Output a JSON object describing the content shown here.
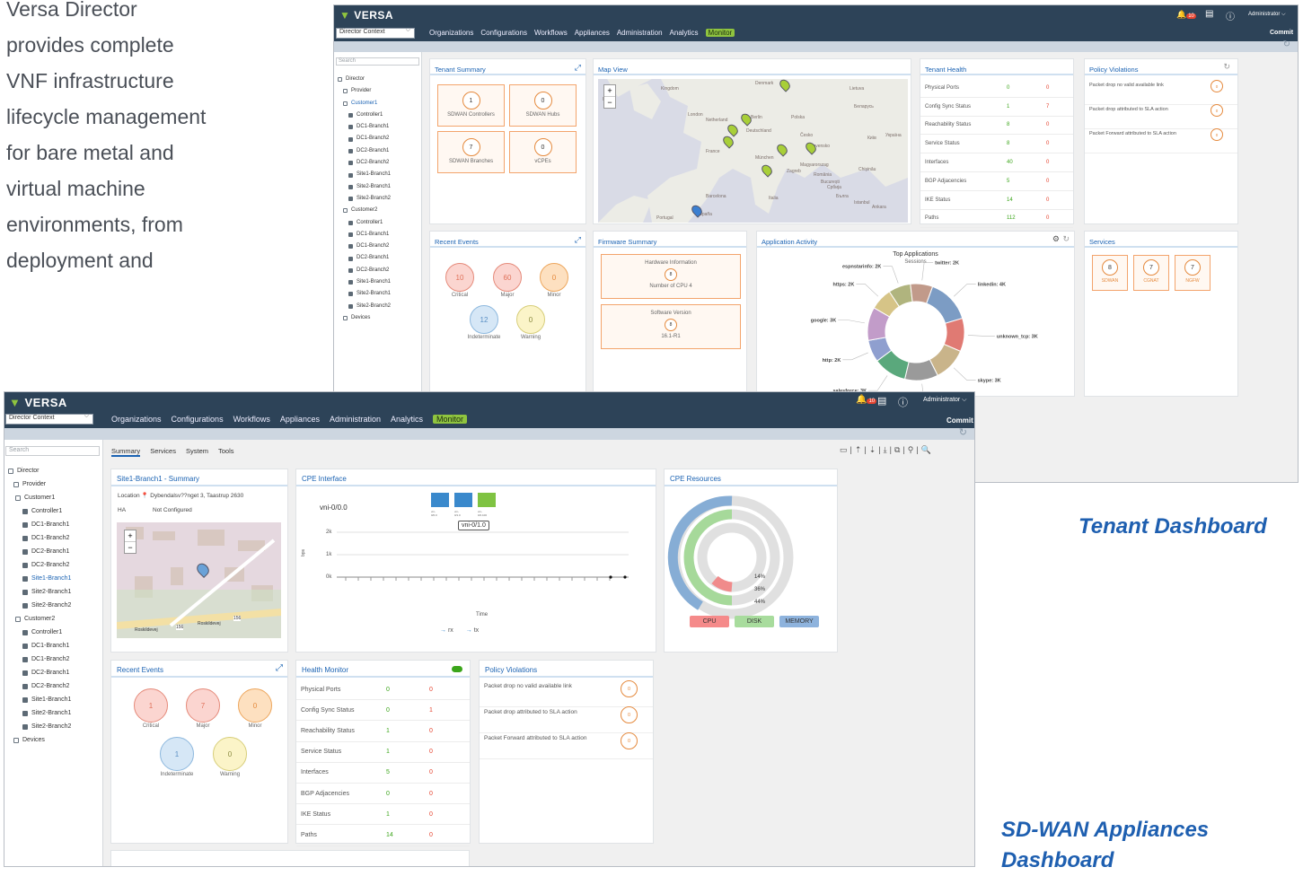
{
  "intro": {
    "line1": "Versa Director",
    "line2": "provides complete",
    "line3": "VNF infrastructure",
    "line4": "lifecycle management",
    "line5": "for bare metal and",
    "line6": "virtual machine",
    "line7": "environments, from",
    "line8": "deployment and"
  },
  "captions": {
    "tenant": "Tenant Dashboard",
    "sdwan_line1": "SD-WAN Appliances",
    "sdwan_line2": "Dashboard"
  },
  "colors": {
    "accent": "#8fc43f",
    "topbar": "#2d4358",
    "panel_title": "#1b63b3",
    "caption": "#1e5fb0"
  },
  "common": {
    "logo": "VERSA",
    "logo_sub": "NETWORKS",
    "context": "Director Context",
    "nav": [
      "Organizations",
      "Configurations",
      "Workflows",
      "Appliances",
      "Administration",
      "Analytics",
      "Monitor"
    ],
    "alerts_badge": "10",
    "user": "Administrator",
    "commit": "Commit",
    "search_placeholder": "Search"
  },
  "tenant": {
    "tree": [
      "Director",
      "Provider",
      "Customer1",
      "Controller1",
      "DC1-Branch1",
      "DC1-Branch2",
      "DC2-Branch1",
      "DC2-Branch2",
      "Site1-Branch1",
      "Site2-Branch1",
      "Site2-Branch2",
      "Customer2",
      "Controller1",
      "DC1-Branch1",
      "DC1-Branch2",
      "DC2-Branch1",
      "DC2-Branch2",
      "Site1-Branch1",
      "Site2-Branch1",
      "Site2-Branch2",
      "Devices"
    ],
    "summary": {
      "title": "Tenant Summary",
      "tiles": [
        {
          "v": "1",
          "l": "SDWAN Controllers"
        },
        {
          "v": "0",
          "l": "SDWAN Hubs"
        },
        {
          "v": "7",
          "l": "SDWAN Branches"
        },
        {
          "v": "0",
          "l": "vCPEs"
        }
      ]
    },
    "map": {
      "title": "Map View",
      "labels": [
        "Kingdom",
        "Ireland",
        "London",
        "Netherland",
        "Berlin",
        "Polska",
        "Deutschland",
        "France",
        "München",
        "Česko",
        "Slovensko",
        "Magyarorszag",
        "Zagreb",
        "România",
        "București",
        "Italia",
        "Barcelona",
        "España",
        "Istanbul",
        "Ankara",
        "Lietuva",
        "Беларусь",
        "Україна",
        "Київ",
        "Chişinău",
        "Србија",
        "Бълга",
        "Denmark",
        "Portugal"
      ],
      "zoom_in": "+",
      "zoom_out": "−"
    },
    "health": {
      "title": "Tenant Health",
      "rows": [
        {
          "k": "Physical Ports",
          "g": "0",
          "r": "0"
        },
        {
          "k": "Config Sync Status",
          "g": "1",
          "r": "7"
        },
        {
          "k": "Reachability Status",
          "g": "8",
          "r": "0"
        },
        {
          "k": "Service Status",
          "g": "8",
          "r": "0"
        },
        {
          "k": "Interfaces",
          "g": "40",
          "r": "0"
        },
        {
          "k": "BGP Adjacencies",
          "g": "5",
          "r": "0"
        },
        {
          "k": "IKE Status",
          "g": "14",
          "r": "0"
        },
        {
          "k": "Paths",
          "g": "112",
          "r": "0"
        }
      ]
    },
    "policy": {
      "title": "Policy Violations",
      "rows": [
        {
          "t": "Packet drop no valid available link",
          "v": "0"
        },
        {
          "t": "Packet drop attributed to SLA action",
          "v": "0"
        },
        {
          "t": "Packet Forward attributed to SLA action",
          "v": "0"
        }
      ]
    },
    "events": {
      "title": "Recent Events",
      "items": [
        {
          "v": "10",
          "l": "Critical"
        },
        {
          "v": "60",
          "l": "Major"
        },
        {
          "v": "0",
          "l": "Minor"
        },
        {
          "v": "12",
          "l": "Indeterminate"
        },
        {
          "v": "0",
          "l": "Warning"
        }
      ]
    },
    "firmware": {
      "title": "Firmware Summary",
      "hw_title": "Hardware Information",
      "hw_v": "8",
      "hw_l": "Number of CPU 4",
      "sw_title": "Software Version",
      "sw_v": "8",
      "sw_l": "16.1-R1"
    },
    "app": {
      "title": "Application Activity",
      "chart_title": "Top Applications",
      "chart_sub": "Sessions"
    },
    "services": {
      "title": "Services",
      "items": [
        {
          "v": "8",
          "l": "SDWAN"
        },
        {
          "v": "7",
          "l": "CGNAT"
        },
        {
          "v": "7",
          "l": "NGFW"
        }
      ]
    }
  },
  "chart_data": {
    "type": "pie",
    "title": "Top Applications",
    "subtitle": "Sessions",
    "categories": [
      "linkedin",
      "unknown_tcp",
      "skype",
      "wikipedia",
      "salesforce",
      "http",
      "google",
      "https",
      "espnstarinfo",
      "twitter"
    ],
    "labels": [
      "linkedin: 4K",
      "unknown_tcp: 3K",
      "skype: 3K",
      "wikipedia: 3K",
      "salesforce: 3K",
      "http: 2K",
      "google: 3K",
      "https: 2K",
      "espnstarinfo: 2K",
      "twitter: 2K"
    ],
    "values": [
      4,
      3,
      3,
      3,
      3,
      2,
      3,
      2,
      2,
      2
    ],
    "colors": [
      "#7c9cc4",
      "#e07a73",
      "#c9b48a",
      "#9a9a9a",
      "#5aa87c",
      "#8f9fcf",
      "#c29cc9",
      "#d6c487",
      "#b0b47e",
      "#c19a8a"
    ]
  },
  "sdwan": {
    "tree": [
      "Director",
      "Provider",
      "Customer1",
      "Controller1",
      "DC1-Branch1",
      "DC1-Branch2",
      "DC2-Branch1",
      "DC2-Branch2",
      "Site1-Branch1",
      "Site2-Branch1",
      "Site2-Branch2",
      "Customer2",
      "Controller1",
      "DC1-Branch1",
      "DC1-Branch2",
      "DC2-Branch1",
      "DC2-Branch2",
      "Site1-Branch1",
      "Site2-Branch1",
      "Site2-Branch2",
      "Devices"
    ],
    "tabs": [
      "Summary",
      "Services",
      "System",
      "Tools"
    ],
    "summary": {
      "title": "Site1-Branch1 - Summary",
      "location_label": "Location",
      "location": "Dybendalsv??nget 3, Taastrup 2630",
      "ha_label": "HA",
      "ha": "Not Configured",
      "roads": [
        "Roskildevej",
        "156",
        "Roskildevej",
        "156"
      ]
    },
    "cpe": {
      "title": "CPE Interface",
      "iface": "vni-0/0.0",
      "tooltip": "vni-0/1.0",
      "y_ticks": [
        "2k",
        "1k",
        "0k"
      ],
      "y_label": "bps",
      "x_label": "Time",
      "legend": [
        "rx",
        "tx"
      ],
      "port_labels": [
        "vni-0/0.0",
        "vni-0/1.0",
        "vni-0/2.100"
      ]
    },
    "resources": {
      "title": "CPE Resources",
      "values": [
        "14%",
        "36%",
        "44%"
      ],
      "buttons": [
        "CPU",
        "DISK",
        "MEMORY"
      ]
    },
    "events": {
      "title": "Recent Events",
      "items": [
        {
          "v": "1",
          "l": "Critical"
        },
        {
          "v": "7",
          "l": "Major"
        },
        {
          "v": "0",
          "l": "Minor"
        },
        {
          "v": "1",
          "l": "Indeterminate"
        },
        {
          "v": "0",
          "l": "Warning"
        }
      ]
    },
    "health": {
      "title": "Health Monitor",
      "rows": [
        {
          "k": "Physical Ports",
          "g": "0",
          "r": "0"
        },
        {
          "k": "Config Sync Status",
          "g": "0",
          "r": "1"
        },
        {
          "k": "Reachability Status",
          "g": "1",
          "r": "0"
        },
        {
          "k": "Service Status",
          "g": "1",
          "r": "0"
        },
        {
          "k": "Interfaces",
          "g": "5",
          "r": "0"
        },
        {
          "k": "BGP Adjacencies",
          "g": "0",
          "r": "0"
        },
        {
          "k": "IKE Status",
          "g": "1",
          "r": "0"
        },
        {
          "k": "Paths",
          "g": "14",
          "r": "0"
        }
      ]
    },
    "policy": {
      "title": "Policy Violations",
      "rows": [
        {
          "t": "Packet drop no valid available link",
          "v": "0"
        },
        {
          "t": "Packet drop attributed to SLA action",
          "v": "0"
        },
        {
          "t": "Packet Forward attributed to SLA action",
          "v": "0"
        }
      ]
    }
  }
}
